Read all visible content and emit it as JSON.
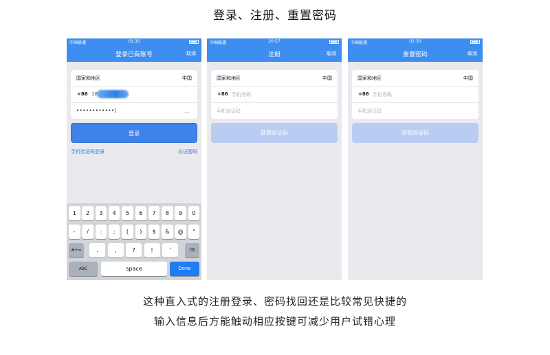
{
  "page_title": "登录、注册、重置密码",
  "phones": [
    {
      "status": {
        "carrier": "中国联通",
        "time": "01:30"
      },
      "nav": {
        "title": "登录已有账号",
        "cancel": "取消"
      },
      "rows": {
        "region_label": "国家和地区",
        "region_value": "中国",
        "code": "+86",
        "phone_prefix": "18",
        "password": "••••••••••••"
      },
      "button": "登录",
      "links": {
        "sms_login": "手机验证码登录",
        "forgot": "忘记密码"
      },
      "keyboard": {
        "row1": [
          "1",
          "2",
          "3",
          "4",
          "5",
          "6",
          "7",
          "8",
          "9",
          "0"
        ],
        "row2": [
          "-",
          "/",
          ":",
          ";",
          "(",
          ")",
          "$",
          "&",
          "@",
          "\""
        ],
        "row3_left": "#+=",
        "row3": [
          ".",
          ",",
          "?",
          "!",
          "'"
        ],
        "abc": "ABC",
        "space": "space",
        "done": "Done"
      }
    },
    {
      "status": {
        "carrier": "中国联通",
        "time": "20:57"
      },
      "nav": {
        "title": "注册",
        "cancel": "取消"
      },
      "rows": {
        "region_label": "国家和地区",
        "region_value": "中国",
        "code": "+86",
        "phone_ph": "手机号码",
        "sms_ph": "手机验证码"
      },
      "button": "获取验证码"
    },
    {
      "status": {
        "carrier": "中国联通",
        "time": "01:30"
      },
      "nav": {
        "title": "重置密码",
        "cancel": "取消"
      },
      "rows": {
        "region_label": "国家和地区",
        "region_value": "中国",
        "code": "+86",
        "phone_ph": "手机号码",
        "sms_ph": "手机验证码"
      },
      "button": "获取验证码"
    }
  ],
  "captions": [
    "这种直入式的注册登录、密码找回还是比较常见快捷的",
    "输入信息后方能触动相应按键可减少用户试错心理"
  ],
  "colors": {
    "accent": "#3d8ef0",
    "button": "#3e83ea",
    "button_disabled": "#b8cdf1"
  }
}
